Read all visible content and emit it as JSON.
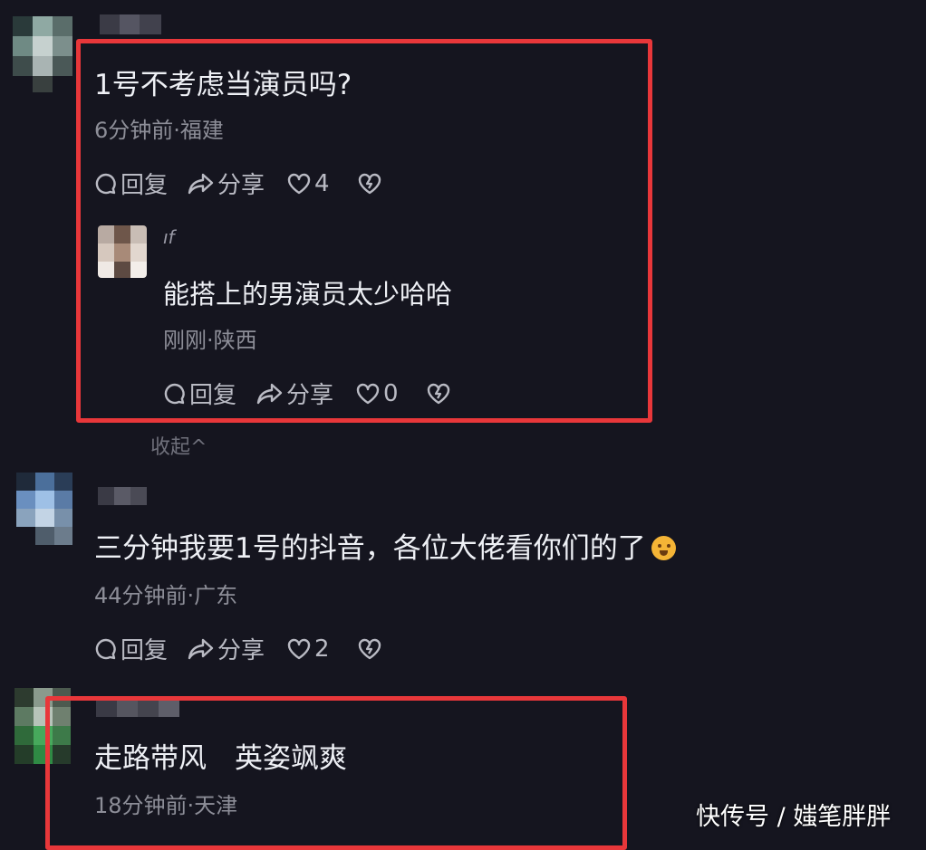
{
  "comments": [
    {
      "text": "1号不考虑当演员吗?",
      "meta": "6分钟前·福建",
      "reply_label": "回复",
      "share_label": "分享",
      "likes": "4",
      "replies": [
        {
          "username": "ıf",
          "text": "能搭上的男演员太少哈哈",
          "meta": "刚刚·陕西",
          "reply_label": "回复",
          "share_label": "分享",
          "likes": "0"
        }
      ],
      "collapse_label": "收起^"
    },
    {
      "text": "三分钟我要1号的抖音，各位大佬看你们的了",
      "meta": "44分钟前·广东",
      "reply_label": "回复",
      "share_label": "分享",
      "likes": "2"
    },
    {
      "text": "走路带风　英姿飒爽",
      "meta": "18分钟前·天津"
    }
  ],
  "watermark": "快传号 / 媸笔胖胖",
  "colors": {
    "background": "#15151f",
    "highlight": "#e8373a",
    "meta": "#8d8e98"
  }
}
